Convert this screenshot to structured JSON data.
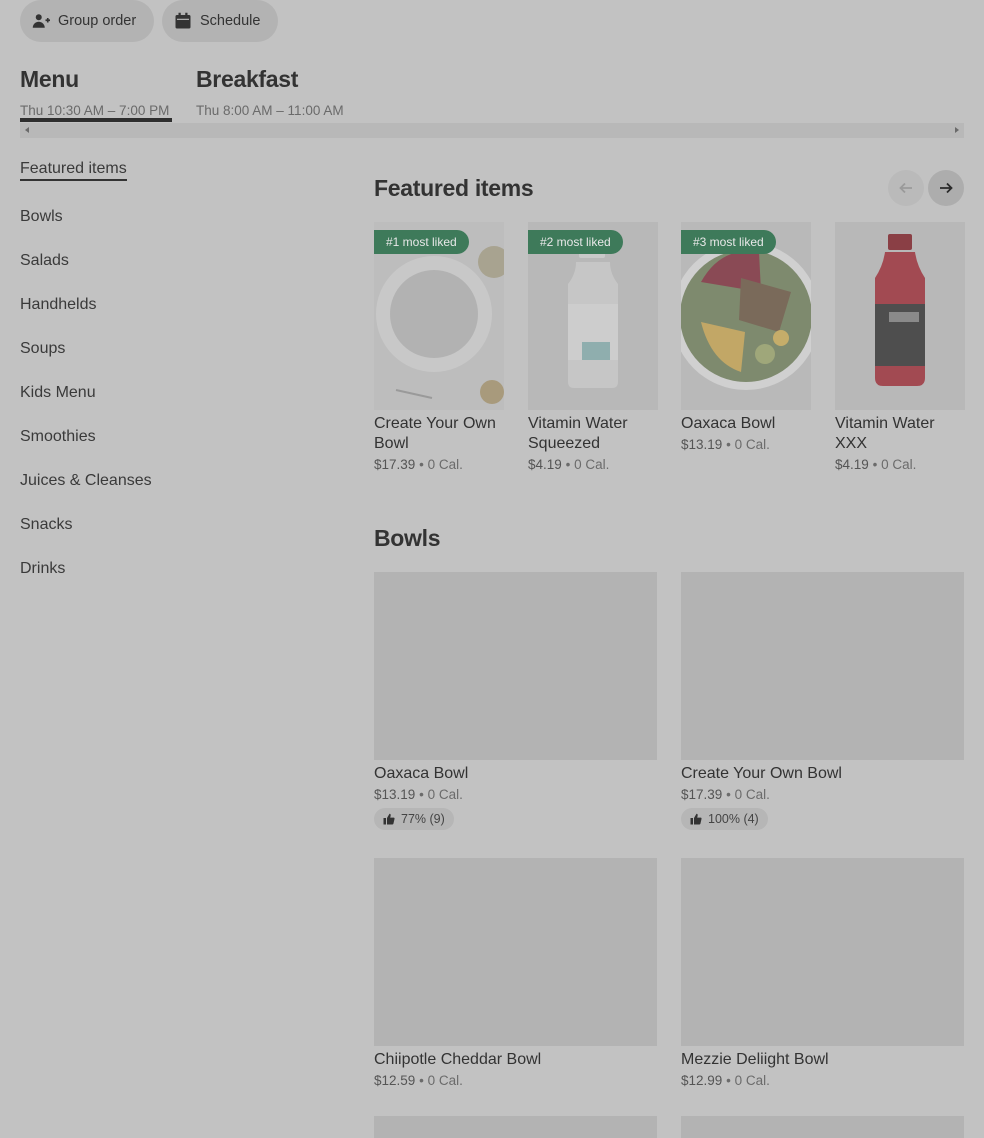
{
  "top_actions": {
    "group_order": "Group order",
    "schedule": "Schedule"
  },
  "menu_tabs": [
    {
      "title": "Menu",
      "hours": "Thu 10:30 AM – 7:00 PM",
      "active": true
    },
    {
      "title": "Breakfast",
      "hours": "Thu 8:00 AM – 11:00 AM",
      "active": false
    }
  ],
  "sidebar": {
    "items": [
      {
        "label": "Featured items",
        "active": true
      },
      {
        "label": "Bowls"
      },
      {
        "label": "Salads"
      },
      {
        "label": "Handhelds"
      },
      {
        "label": "Soups"
      },
      {
        "label": "Kids Menu"
      },
      {
        "label": "Smoothies"
      },
      {
        "label": "Juices & Cleanses"
      },
      {
        "label": "Snacks"
      },
      {
        "label": "Drinks"
      }
    ]
  },
  "featured": {
    "title": "Featured items",
    "items": [
      {
        "name": "Create Your Own Bowl",
        "price": "$17.39",
        "calories": "0 Cal.",
        "badge": "#1 most liked",
        "image": "white-bowl"
      },
      {
        "name": "Vitamin Water Squeezed",
        "price": "$4.19",
        "calories": "0 Cal.",
        "badge": "#2 most liked",
        "image": "vitaminwater-zero-bottle"
      },
      {
        "name": "Oaxaca Bowl",
        "price": "$13.19",
        "calories": "0 Cal.",
        "badge": "#3 most liked",
        "image": "oaxaca-bowl"
      },
      {
        "name": "Vitamin Water XXX",
        "price": "$4.19",
        "calories": "0 Cal.",
        "badge": "",
        "image": "vitaminwater-xxx-bottle"
      }
    ]
  },
  "bowls": {
    "title": "Bowls",
    "items": [
      {
        "name": "Oaxaca Bowl",
        "price": "$13.19",
        "calories": "0 Cal.",
        "rating": "77% (9)"
      },
      {
        "name": "Create Your Own Bowl",
        "price": "$17.39",
        "calories": "0 Cal.",
        "rating": "100% (4)"
      },
      {
        "name": "Chiipotle Cheddar Bowl",
        "price": "$12.59",
        "calories": "0 Cal.",
        "rating": ""
      },
      {
        "name": "Mezzie Deliight Bowl",
        "price": "$12.99",
        "calories": "0 Cal.",
        "rating": ""
      }
    ]
  },
  "separator": "•",
  "colors": {
    "overlay_background": "#c2c2c2",
    "badge_green": "#3e7a5a",
    "text_dark": "#333333"
  }
}
